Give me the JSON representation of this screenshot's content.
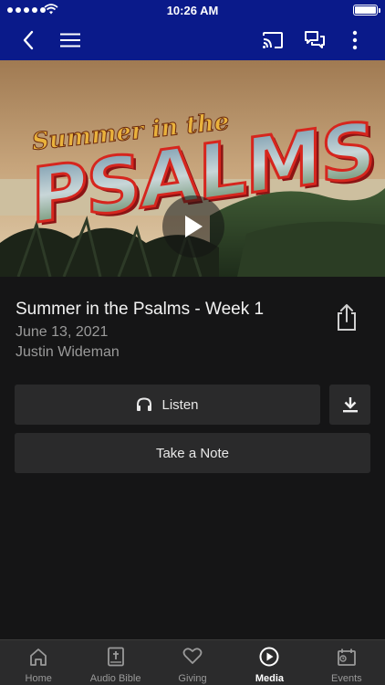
{
  "status_bar": {
    "time": "10:26 AM"
  },
  "nav": {
    "back_icon": "chevron-left-icon",
    "menu_icon": "hamburger-menu-icon",
    "cast_icon": "cast-icon",
    "chat_icon": "chat-bubbles-icon",
    "more_icon": "vertical-ellipsis-icon",
    "bar_color": "#0a1a8a"
  },
  "hero": {
    "script_text": "Summer in the",
    "block_text": "PSALMS",
    "play_icon": "play-icon"
  },
  "media": {
    "title": "Summer in the Psalms - Week 1",
    "date": "June 13, 2021",
    "speaker": "Justin Wideman",
    "share_icon": "share-icon"
  },
  "actions": {
    "listen_label": "Listen",
    "listen_icon": "headphones-icon",
    "download_icon": "download-icon",
    "note_label": "Take a Note"
  },
  "tabs": [
    {
      "label": "Home",
      "icon": "home-icon",
      "active": false
    },
    {
      "label": "Audio Bible",
      "icon": "bible-icon",
      "active": false
    },
    {
      "label": "Giving",
      "icon": "heart-icon",
      "active": false
    },
    {
      "label": "Media",
      "icon": "play-circle-icon",
      "active": true
    },
    {
      "label": "Events",
      "icon": "calendar-icon",
      "active": false
    }
  ]
}
